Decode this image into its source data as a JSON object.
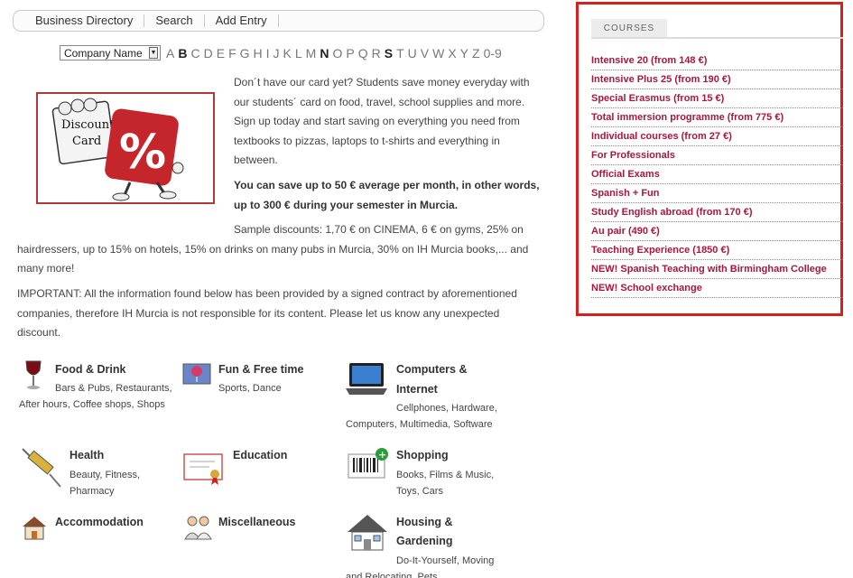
{
  "nav": {
    "items": [
      "Business Directory",
      "Search",
      "Add Entry"
    ]
  },
  "filter": {
    "select_value": "Company Name",
    "letters": [
      "A",
      "B",
      "C",
      "D",
      "E",
      "F",
      "G",
      "H",
      "I",
      "J",
      "K",
      "L",
      "M",
      "N",
      "O",
      "P",
      "Q",
      "R",
      "S",
      "T",
      "U",
      "V",
      "W",
      "X",
      "Y",
      "Z",
      "0-9"
    ]
  },
  "promo": {
    "card_text_1": "Discount",
    "card_text_2": "Card",
    "intro": "Don´t have our card yet? Students save money everyday with our students´ card on food, travel, school supplies and more. Sign up today and start saving on everything you need from textbooks to pizzas, laptops to t-shirts and everything in between.",
    "highlight": "You can save up to 50 € average per month, in other words, up to 300 € during your semester in Murcia.",
    "sample_line1": "Sample discounts: 1,70 € on CINEMA, 6 € on gyms, 25% on",
    "sample_line2": "hairdressers, up to 15% on hotels, 15% on drinks on many pubs in Murcia, 30% on IH Murcia books,... and",
    "sample_line3": "many more!",
    "important": "IMPORTANT: All the information found below has been provided by a signed contract by aforementioned companies, therefore IH Murcia is not responsible for its content. Please let us know any unexpected discount."
  },
  "categories": {
    "food": {
      "title": "Food & Drink",
      "sub1": "Bars & Pubs, Restaurants,",
      "sub2": "After hours, Coffee shops, Shops"
    },
    "fun": {
      "title": "Fun & Free time",
      "sub1": "Sports, Dance"
    },
    "computers": {
      "title1": "Computers &",
      "title2": "Internet",
      "sub1": "Cellphones, Hardware,",
      "sub2": "Computers, Multimedia, Software"
    },
    "health": {
      "title": "Health",
      "sub1": "Beauty, Fitness,",
      "sub2": "Pharmacy"
    },
    "education": {
      "title": "Education"
    },
    "shopping": {
      "title": "Shopping",
      "sub1": "Books, Films & Music,",
      "sub2": "Toys, Cars"
    },
    "accommodation": {
      "title": "Accommodation"
    },
    "misc": {
      "title": "Miscellaneous"
    },
    "housing": {
      "title1": "Housing &",
      "title2": "Gardening",
      "sub1": "Do-It-Yourself, Moving",
      "sub2": "and Relocating, Pets"
    }
  },
  "courses": {
    "heading": "COURSES",
    "items": [
      "Intensive 20 (from 148 €)",
      "Intensive Plus 25 (from 190 €)",
      "Special Erasmus (from 15 €)",
      "Total immersion programme (from 775 €)",
      "Individual courses (from 27 €)",
      "For Professionals",
      "Official Exams",
      "Spanish + Fun",
      "Study English abroad (from 170 €)",
      "Au pair (490 €)",
      "Teaching Experience (1850 €)",
      "NEW! Spanish Teaching with Birmingham College",
      "NEW! School exchange"
    ]
  },
  "colors": {
    "course_link": "#a8173f",
    "panel_border": "#d42020"
  }
}
